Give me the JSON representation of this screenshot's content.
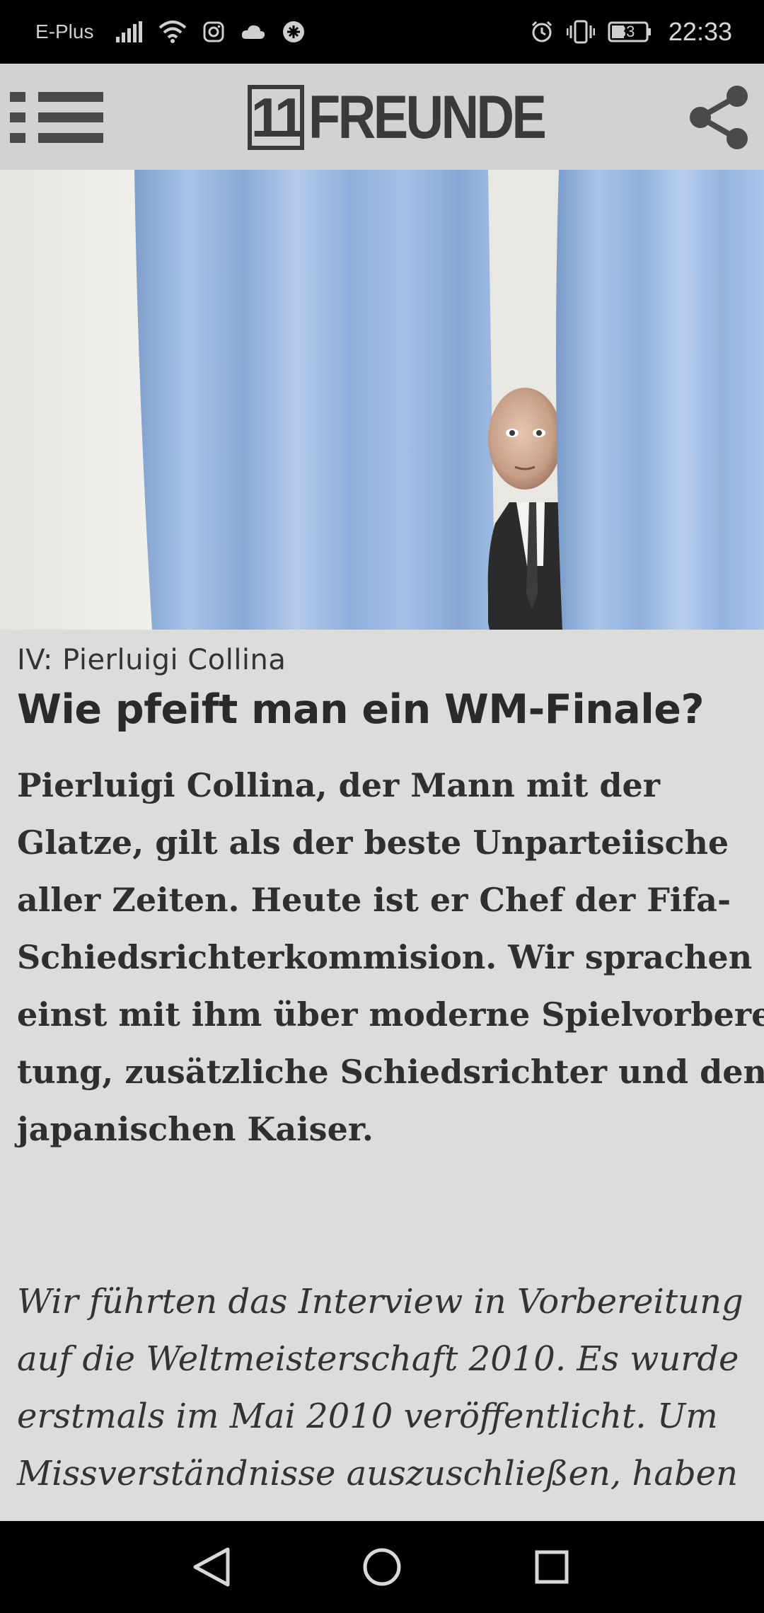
{
  "status_bar": {
    "carrier": "E-Plus",
    "battery": "33",
    "time": "22:33",
    "icons": [
      "signal-icon",
      "wifi-icon",
      "instagram-icon",
      "cloud-icon",
      "app-badge-icon",
      "alarm-icon",
      "vibrate-icon",
      "battery-icon"
    ]
  },
  "header": {
    "logo_number": "11",
    "logo_text": "FREUNDE",
    "menu_icon": "menu-icon",
    "share_icon": "share-icon"
  },
  "hero": {
    "subject": "photo-curtain-man"
  },
  "article": {
    "kicker": "IV: Pierluigi Collina",
    "headline": "Wie pfeift man ein WM-Finale?",
    "lead_lines": [
      "Pierluigi Collina, der Mann mit der",
      "Glatze, gilt als der beste Unparteiische",
      "aller Zeiten. Heute ist er Chef der Fifa-",
      "Schiedsrichterkommision. Wir sprachen",
      "einst mit ihm über moderne Spielvorberei-",
      "tung, zusätzliche Schiedsrichter und den",
      "japanischen Kaiser."
    ],
    "intro_lines": [
      "Wir führten das Interview in Vorbereitung",
      "auf die Weltmeisterschaft 2010. Es wurde",
      "erstmals im Mai 2010 veröffentlicht. Um",
      "Missverständnisse auszuschließen, haben"
    ]
  },
  "nav": {
    "icons": [
      "back-icon",
      "home-icon",
      "recents-icon"
    ]
  },
  "colors": {
    "header_bg": "#d2d2d2",
    "content_bg": "#dcdcdc",
    "curtain_blue": "#9db9df"
  }
}
